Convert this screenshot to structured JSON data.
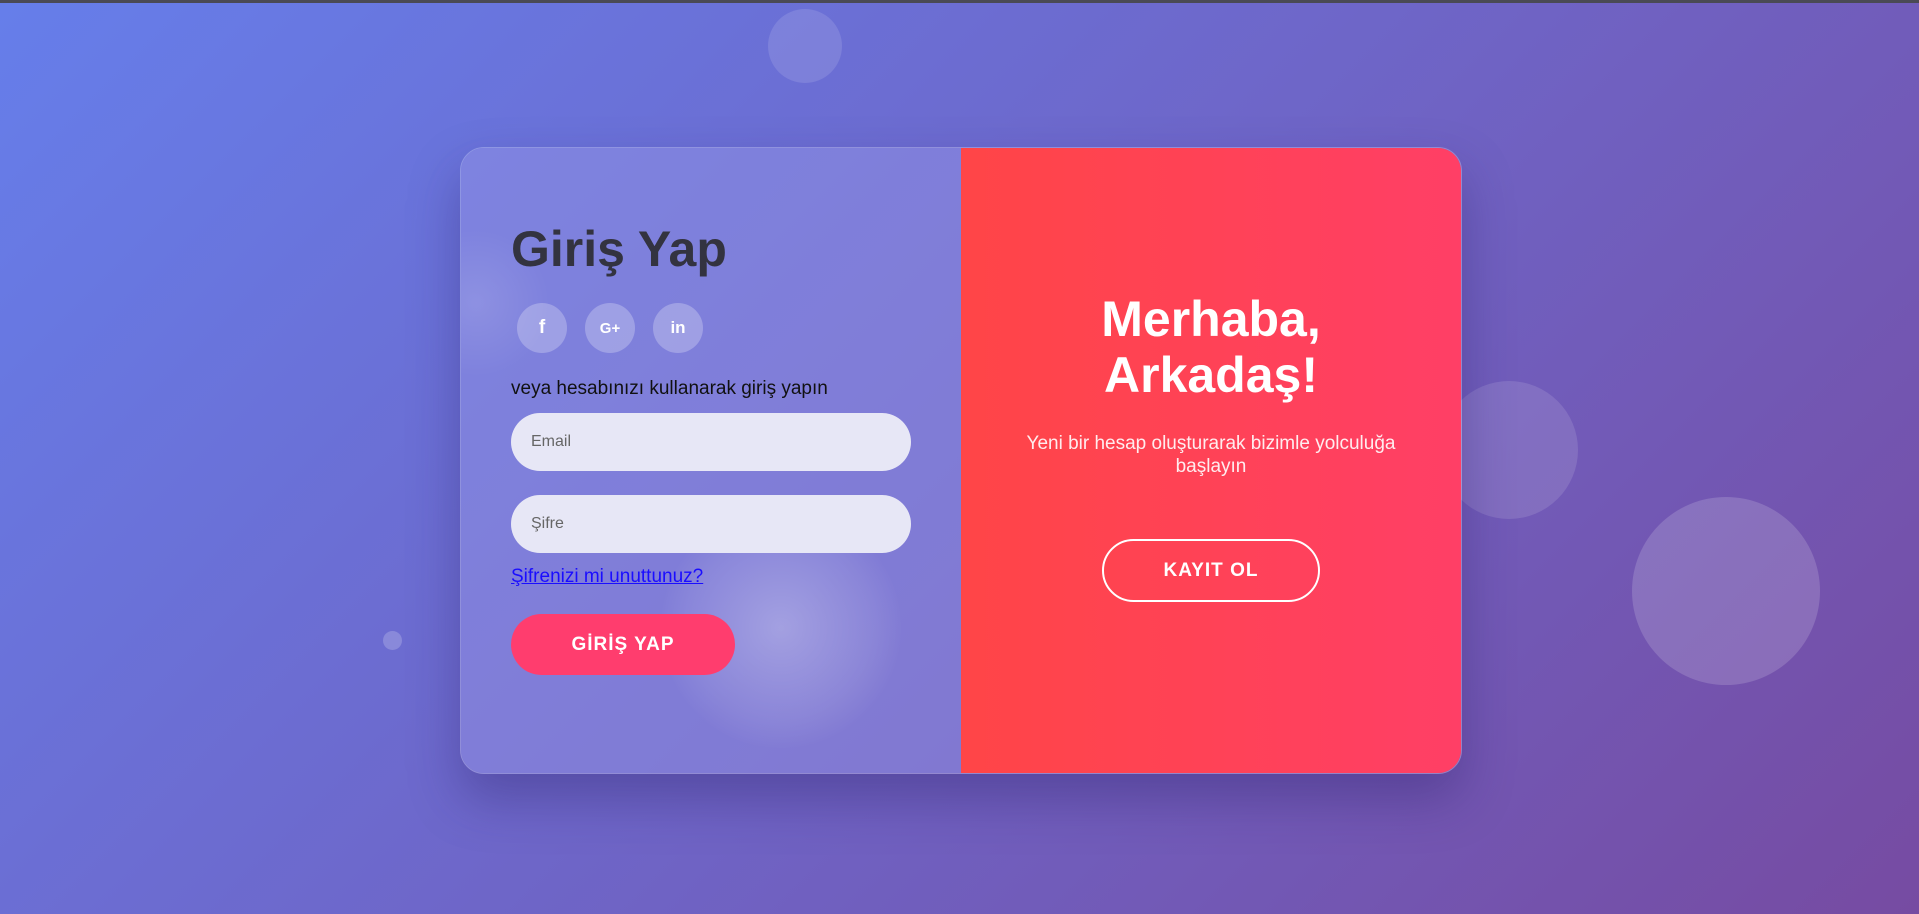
{
  "login": {
    "title": "Giriş Yap",
    "social": [
      {
        "icon": "facebook-icon",
        "glyph": "f"
      },
      {
        "icon": "google-plus-icon",
        "glyph": "G+"
      },
      {
        "icon": "linkedin-icon",
        "glyph": "in"
      }
    ],
    "hint": "veya hesabınızı kullanarak giriş yapın",
    "email_placeholder": "Email",
    "password_placeholder": "Şifre",
    "forgot_label": "Şifrenizi mi unuttunuz?",
    "submit_label": "GİRİŞ YAP"
  },
  "signup": {
    "greeting_line1": "Merhaba,",
    "greeting_line2": "Arkadaş!",
    "subtitle": "Yeni bir hesap oluşturarak bizimle yolculuğa başlayın",
    "button_label": "KAYIT OL"
  },
  "colors": {
    "accent": "#ff3d6e",
    "panel_gradient_start": "#ff4547",
    "panel_gradient_end": "#ff3f66",
    "background_start": "#667eea",
    "background_end": "#764ba2"
  }
}
